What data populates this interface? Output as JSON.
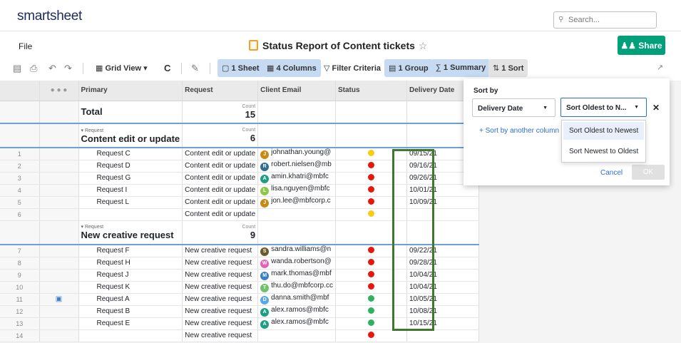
{
  "app": {
    "logo": "smartsheet",
    "search_placeholder": "Search..."
  },
  "titlebar": {
    "file_menu": "File",
    "title": "Status Report of Content tickets",
    "share_label": "Share"
  },
  "toolbar": {
    "grid_view": "Grid View",
    "sheet_btn": "1 Sheet",
    "columns_btn": "4 Columns",
    "filter_btn": "Filter Criteria",
    "group_btn": "1 Group",
    "summary_btn": "1 Summary",
    "sort_btn": "1 Sort"
  },
  "columns": [
    "Primary",
    "Request",
    "Client Email",
    "Status",
    "Delivery Date"
  ],
  "total": {
    "label": "Total",
    "count_label": "Count",
    "count": "15"
  },
  "groups": [
    {
      "group_label": "Request",
      "name": "Content edit or update",
      "count_label": "Count",
      "count": "6"
    },
    {
      "group_label": "Request",
      "name": "New creative request",
      "count_label": "Count",
      "count": "9"
    }
  ],
  "rows": [
    {
      "n": "1",
      "primary": "Request C",
      "request": "Content edit or update",
      "initial": "J",
      "email": "johnathan.young@",
      "status": "yellow",
      "date": "09/15/21"
    },
    {
      "n": "2",
      "primary": "Request D",
      "request": "Content edit or update",
      "initial": "R",
      "email": "robert.nielsen@mb",
      "status": "red",
      "date": "09/16/21"
    },
    {
      "n": "3",
      "primary": "Request G",
      "request": "Content edit or update",
      "initial": "A",
      "email": "amin.khatri@mbfc",
      "status": "red",
      "date": "09/26/21"
    },
    {
      "n": "4",
      "primary": "Request I",
      "request": "Content edit or update",
      "initial": "L",
      "email": "lisa.nguyen@mbfc",
      "status": "red",
      "date": "10/01/21"
    },
    {
      "n": "5",
      "primary": "Request L",
      "request": "Content edit or update",
      "initial": "J",
      "email": "jon.lee@mbfcorp.c",
      "status": "red",
      "date": "10/09/21"
    },
    {
      "n": "6",
      "primary": "",
      "request": "Content edit or update",
      "initial": "",
      "email": "",
      "status": "yellow",
      "date": ""
    },
    {
      "n": "7",
      "primary": "Request F",
      "request": "New creative request",
      "initial": "S",
      "email": "sandra.williams@n",
      "status": "red",
      "date": "09/22/21"
    },
    {
      "n": "8",
      "primary": "Request H",
      "request": "New creative request",
      "initial": "W",
      "email": "wanda.robertson@",
      "status": "red",
      "date": "09/28/21"
    },
    {
      "n": "9",
      "primary": "Request J",
      "request": "New creative request",
      "initial": "M",
      "email": "mark.thomas@mbf",
      "status": "red",
      "date": "10/04/21"
    },
    {
      "n": "10",
      "primary": "Request K",
      "request": "New creative request",
      "initial": "T",
      "email": "thu.do@mbfcorp.cc",
      "status": "red",
      "date": "10/04/21"
    },
    {
      "n": "11",
      "primary": "Request A",
      "request": "New creative request",
      "initial": "D",
      "email": "danna.smith@mbf",
      "status": "green",
      "date": "10/05/21"
    },
    {
      "n": "12",
      "primary": "Request B",
      "request": "New creative request",
      "initial": "A",
      "email": "alex.ramos@mbfc",
      "status": "green",
      "date": "10/08/21"
    },
    {
      "n": "13",
      "primary": "Request E",
      "request": "New creative request",
      "initial": "A",
      "email": "alex.ramos@mbfc",
      "status": "green",
      "date": "10/15/21"
    },
    {
      "n": "14",
      "primary": "",
      "request": "New creative request",
      "initial": "",
      "email": "",
      "status": "red",
      "date": ""
    }
  ],
  "colors": {
    "status_red": "#e8160c",
    "status_yellow": "#f9cc11",
    "status_green": "#2fb160",
    "avatars": {
      "J": "#c88a12",
      "R": "#2f6e8c",
      "A": "#1f9e82",
      "L": "#8fc74a",
      "S": "#6b5b2a",
      "W": "#e75fb7",
      "M": "#3b7fc4",
      "T": "#6fc26a",
      "D": "#5aa9e6"
    }
  },
  "sort_panel": {
    "title": "Sort by",
    "column_select": "Delivery Date",
    "order_select": "Sort Oldest to N...",
    "add_link": "+  Sort by another column",
    "cancel": "Cancel",
    "ok": "OK",
    "options": [
      "Sort Oldest to Newest",
      "Sort Newest to Oldest"
    ]
  }
}
